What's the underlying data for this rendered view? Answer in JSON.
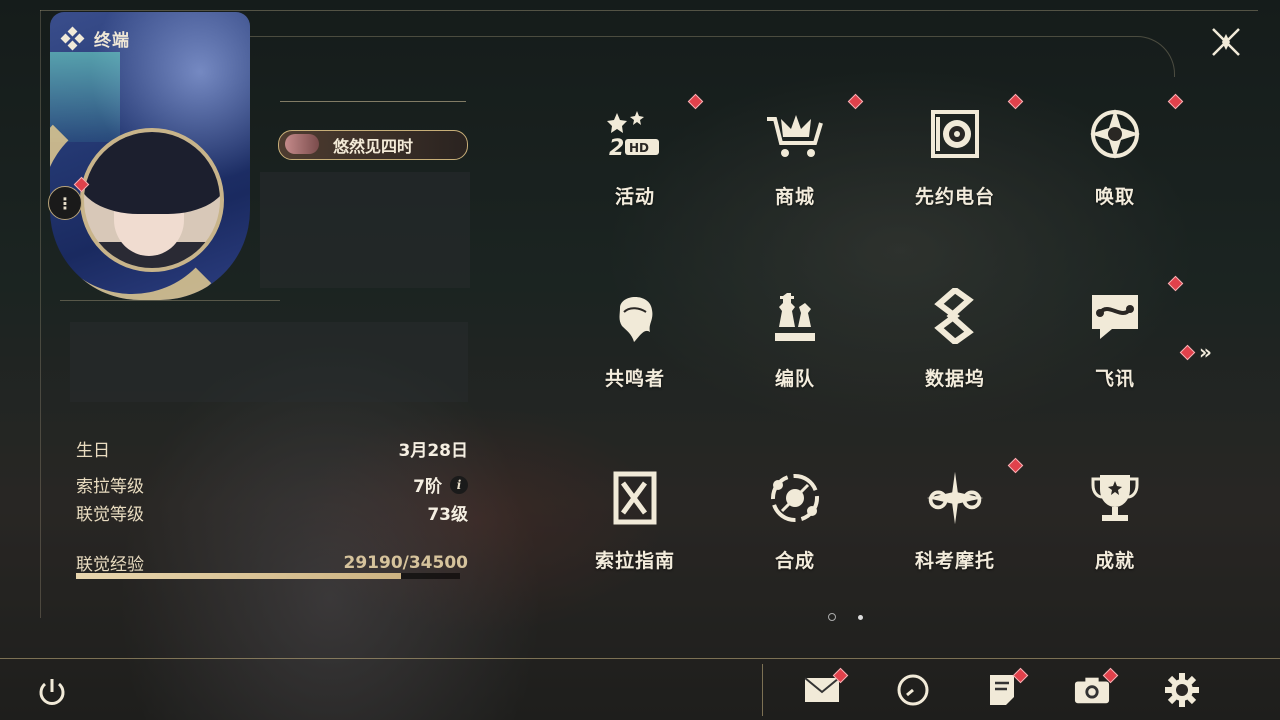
{
  "header": {
    "title": "终端"
  },
  "profile": {
    "title_plate": "悠然见四时",
    "stats": [
      {
        "label": "生日",
        "value": "3月28日"
      },
      {
        "label": "索拉等级",
        "value": "7阶"
      },
      {
        "label": "联觉等级",
        "value": "73级"
      }
    ],
    "exp": {
      "label": "联觉经验",
      "value": "29190/34500",
      "progress": 0.846
    }
  },
  "menu": {
    "items": [
      {
        "label": "活动",
        "icon": "event-2hd-icon",
        "badge": true
      },
      {
        "label": "商城",
        "icon": "shop-crown-cart-icon",
        "badge": true
      },
      {
        "label": "先约电台",
        "icon": "radio-icon",
        "badge": true
      },
      {
        "label": "唤取",
        "icon": "summon-compass-icon",
        "badge": true
      },
      {
        "label": "共鸣者",
        "icon": "resonator-head-icon",
        "badge": false
      },
      {
        "label": "编队",
        "icon": "team-chess-icon",
        "badge": false
      },
      {
        "label": "数据坞",
        "icon": "data-dock-icon",
        "badge": false
      },
      {
        "label": "飞讯",
        "icon": "message-chat-icon",
        "badge": true
      },
      {
        "label": "索拉指南",
        "icon": "guide-book-icon",
        "badge": false
      },
      {
        "label": "合成",
        "icon": "synthesis-icon",
        "badge": false
      },
      {
        "label": "科考摩托",
        "icon": "motorcycle-icon",
        "badge": true
      },
      {
        "label": "成就",
        "icon": "trophy-icon",
        "badge": false
      }
    ],
    "next_page_icon": "double-chevron-right-icon",
    "pages": 2,
    "current_page": 1
  },
  "bottom_bar": {
    "icons": [
      "mail-icon",
      "clock-icon",
      "notes-icon",
      "camera-icon",
      "settings-gear-icon"
    ]
  },
  "colors": {
    "accent": "#c8b48a",
    "badge": "#e0414b",
    "text": "#f3ecdc"
  }
}
